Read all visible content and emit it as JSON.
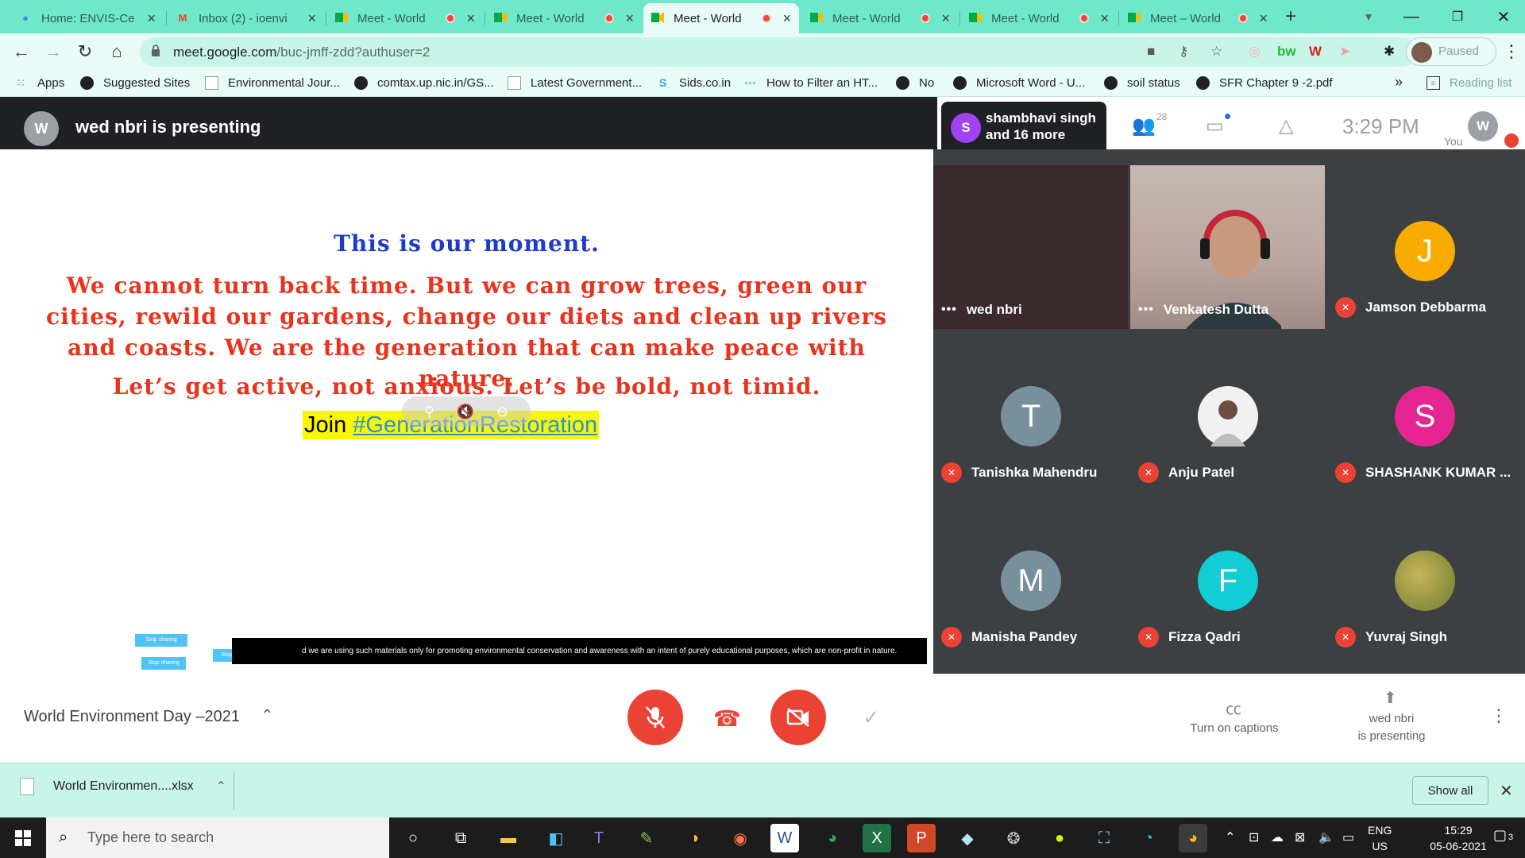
{
  "browser": {
    "tabs": [
      {
        "title": "Home: ENVIS-Ce",
        "icon": "google-icon"
      },
      {
        "title": "Inbox (2) - ioenvi",
        "icon": "gmail-icon"
      },
      {
        "title": "Meet - World",
        "icon": "meet-icon",
        "recording": true
      },
      {
        "title": "Meet - World",
        "icon": "meet-icon",
        "recording": true
      },
      {
        "title": "Meet - World",
        "icon": "meet-icon",
        "recording": true,
        "active": true
      },
      {
        "title": "Meet - World",
        "icon": "meet-icon",
        "recording": true
      },
      {
        "title": "Meet - World",
        "icon": "meet-icon",
        "recording": true
      },
      {
        "title": "Meet – World",
        "icon": "meet-icon",
        "recording": true
      }
    ],
    "url_host": "meet.google.com",
    "url_path": "/buc-jmff-zdd?authuser=2",
    "profile_label": "Paused",
    "bookmarks": [
      {
        "label": "Apps"
      },
      {
        "label": "Suggested Sites"
      },
      {
        "label": "Environmental Jour..."
      },
      {
        "label": "comtax.up.nic.in/GS..."
      },
      {
        "label": "Latest Government..."
      },
      {
        "label": "Sids.co.in"
      },
      {
        "label": "How to Filter an HT..."
      },
      {
        "label": "No"
      },
      {
        "label": "Microsoft Word - U..."
      },
      {
        "label": "soil status"
      },
      {
        "label": "SFR Chapter 9 -2.pdf"
      }
    ],
    "bookmarks_more": "»",
    "reading_list": "Reading list"
  },
  "meet": {
    "presenter_initial": "W",
    "presenter_text": "wed nbri is presenting",
    "join_initial": "S",
    "join_line1": "shambhavi singh",
    "join_line2": "and 16 more",
    "people_count": "28",
    "clock": "3:29 PM",
    "you_initial": "W",
    "you_label": "You",
    "slide": {
      "line1": "This is our moment.",
      "line2": "We cannot turn back time. But we can grow trees, green our cities, rewild our gardens, change our diets and clean up rivers and coasts. We are the generation that can make peace with nature.",
      "line3": "Let’s get active, not anxious. Let’s be bold, not timid.",
      "join_word": "Join",
      "hashtag": "#GenerationRestoration",
      "disclaimer": "d we are using such materials only for  promoting environmental conservation and awareness with an intent of purely educational purposes, which are non-profit in nature.",
      "stop_sharing": "Stop sharing"
    },
    "participants": [
      {
        "name": "wed nbri",
        "video": true,
        "muted": false
      },
      {
        "name": "Venkatesh Dutta",
        "video": true,
        "muted": false
      },
      {
        "name": "Jamson Debbarma",
        "initial": "J",
        "color": "#f9ab00",
        "muted": true
      },
      {
        "name": "Tanishka Mahendru",
        "initial": "T",
        "color": "#78909c",
        "muted": true
      },
      {
        "name": "Anju Patel",
        "photo": true,
        "muted": true
      },
      {
        "name": "SHASHANK KUMAR ...",
        "initial": "S",
        "color": "#e52592",
        "muted": true
      },
      {
        "name": "Manisha Pandey",
        "initial": "M",
        "color": "#78909c",
        "muted": true
      },
      {
        "name": "Fizza Qadri",
        "initial": "F",
        "color": "#12cdd4",
        "muted": true
      },
      {
        "name": "Yuvraj Singh",
        "photo": true,
        "muted": true
      }
    ],
    "meeting_name": "World Environment Day –2021",
    "captions_label": "Turn on captions",
    "presenting_line1": "wed nbri",
    "presenting_line2": "is presenting"
  },
  "downloads": {
    "filename": "World Environmen....xlsx",
    "show_all": "Show all"
  },
  "taskbar": {
    "search_placeholder": "Type here to search",
    "lang1": "ENG",
    "lang2": "US",
    "time": "15:29",
    "date": "05-06-2021",
    "notifications": "3"
  },
  "colors": {
    "chrome_theme": "#6fe7c9",
    "meet_dark": "#202124",
    "meet_red": "#ea4335",
    "slide_blue": "#1f3bcc",
    "slide_red": "#e8331d",
    "highlight_yellow": "#f8f800"
  }
}
